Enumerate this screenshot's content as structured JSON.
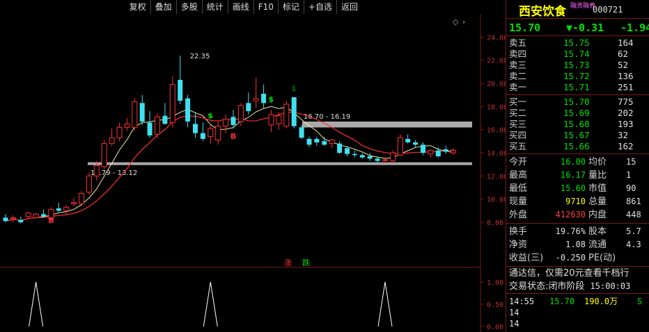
{
  "toolbar": [
    "复权",
    "叠加",
    "多股",
    "统计",
    "画线",
    "F10",
    "标记",
    "+自选",
    "返回"
  ],
  "chart_data": {
    "type": "candlestick",
    "y_axis_ticks": [
      "24.00",
      "22.00",
      "20.00",
      "18.00",
      "16.00",
      "14.00",
      "12.00",
      "10.00",
      "8.00"
    ],
    "ylim": [
      7.4,
      25.4
    ],
    "indicator_ticks": [
      "1.00",
      "0.50",
      "0.00"
    ],
    "candles": [
      {
        "o": 8.4,
        "h": 8.7,
        "l": 8.0,
        "c": 8.1
      },
      {
        "o": 8.3,
        "h": 8.6,
        "l": 8.0,
        "c": 8.4
      },
      {
        "o": 8.2,
        "h": 8.5,
        "l": 7.9,
        "c": 8.0
      },
      {
        "o": 8.5,
        "h": 8.9,
        "l": 8.3,
        "c": 8.8
      },
      {
        "o": 8.4,
        "h": 8.8,
        "l": 8.3,
        "c": 8.7
      },
      {
        "o": 8.7,
        "h": 9.1,
        "l": 8.4,
        "c": 8.5
      },
      {
        "o": 8.3,
        "h": 9.3,
        "l": 8.1,
        "c": 9.1
      },
      {
        "o": 9.2,
        "h": 9.7,
        "l": 8.9,
        "c": 9.0
      },
      {
        "o": 9.0,
        "h": 9.5,
        "l": 8.7,
        "c": 9.3
      },
      {
        "o": 9.6,
        "h": 10.1,
        "l": 9.4,
        "c": 9.7
      },
      {
        "o": 9.6,
        "h": 10.7,
        "l": 9.4,
        "c": 10.5
      },
      {
        "o": 10.6,
        "h": 12.3,
        "l": 10.4,
        "c": 12.0
      },
      {
        "o": 12.0,
        "h": 13.3,
        "l": 11.6,
        "c": 12.9
      },
      {
        "o": 12.8,
        "h": 15.1,
        "l": 12.6,
        "c": 14.8
      },
      {
        "o": 14.8,
        "h": 16.1,
        "l": 14.6,
        "c": 15.3
      },
      {
        "o": 15.3,
        "h": 16.6,
        "l": 15.0,
        "c": 16.2
      },
      {
        "o": 16.2,
        "h": 17.0,
        "l": 15.9,
        "c": 16.5
      },
      {
        "o": 16.2,
        "h": 18.7,
        "l": 15.9,
        "c": 18.4
      },
      {
        "o": 18.3,
        "h": 19.0,
        "l": 16.4,
        "c": 16.7
      },
      {
        "o": 16.6,
        "h": 17.6,
        "l": 15.3,
        "c": 15.5
      },
      {
        "o": 15.6,
        "h": 17.4,
        "l": 15.3,
        "c": 17.1
      },
      {
        "o": 17.2,
        "h": 18.3,
        "l": 16.4,
        "c": 16.5
      },
      {
        "o": 16.6,
        "h": 20.6,
        "l": 16.2,
        "c": 19.9
      },
      {
        "o": 20.3,
        "h": 22.4,
        "l": 18.2,
        "c": 18.5
      },
      {
        "o": 18.7,
        "h": 19.0,
        "l": 16.2,
        "c": 16.7
      },
      {
        "o": 16.5,
        "h": 17.5,
        "l": 15.3,
        "c": 15.7
      },
      {
        "o": 15.7,
        "h": 16.6,
        "l": 15.0,
        "c": 15.2
      },
      {
        "o": 15.4,
        "h": 16.4,
        "l": 14.8,
        "c": 16.1
      },
      {
        "o": 15.1,
        "h": 16.8,
        "l": 14.7,
        "c": 16.3
      },
      {
        "o": 16.3,
        "h": 17.3,
        "l": 15.7,
        "c": 16.9
      },
      {
        "o": 17.1,
        "h": 17.7,
        "l": 16.1,
        "c": 16.4
      },
      {
        "o": 16.7,
        "h": 18.3,
        "l": 16.3,
        "c": 18.1
      },
      {
        "o": 18.3,
        "h": 19.2,
        "l": 17.3,
        "c": 17.6
      },
      {
        "o": 18.5,
        "h": 20.5,
        "l": 17.9,
        "c": 18.7
      },
      {
        "o": 19.1,
        "h": 19.9,
        "l": 17.8,
        "c": 18.3
      },
      {
        "o": 16.4,
        "h": 17.7,
        "l": 15.8,
        "c": 17.3
      },
      {
        "o": 16.5,
        "h": 17.5,
        "l": 16.0,
        "c": 17.2
      },
      {
        "o": 16.3,
        "h": 18.5,
        "l": 16.1,
        "c": 18.2
      },
      {
        "o": 18.8,
        "h": 18.8,
        "l": 16.1,
        "c": 16.3
      },
      {
        "o": 16.2,
        "h": 16.4,
        "l": 15.2,
        "c": 15.3
      },
      {
        "o": 15.2,
        "h": 15.4,
        "l": 14.5,
        "c": 14.7
      },
      {
        "o": 15.2,
        "h": 15.4,
        "l": 14.6,
        "c": 14.9
      },
      {
        "o": 15.0,
        "h": 15.4,
        "l": 14.6,
        "c": 14.7
      },
      {
        "o": 14.8,
        "h": 15.2,
        "l": 14.4,
        "c": 15.1
      },
      {
        "o": 14.8,
        "h": 15.0,
        "l": 13.9,
        "c": 14.0
      },
      {
        "o": 14.4,
        "h": 14.6,
        "l": 13.7,
        "c": 13.9
      },
      {
        "o": 13.9,
        "h": 14.2,
        "l": 13.6,
        "c": 13.8
      },
      {
        "o": 13.8,
        "h": 14.0,
        "l": 13.5,
        "c": 13.6
      },
      {
        "o": 13.7,
        "h": 14.0,
        "l": 13.3,
        "c": 13.5
      },
      {
        "o": 13.5,
        "h": 13.7,
        "l": 13.2,
        "c": 13.3
      },
      {
        "o": 13.4,
        "h": 13.6,
        "l": 13.1,
        "c": 13.4
      },
      {
        "o": 13.3,
        "h": 14.2,
        "l": 13.1,
        "c": 14.0
      },
      {
        "o": 13.8,
        "h": 15.6,
        "l": 13.7,
        "c": 15.3
      },
      {
        "o": 15.2,
        "h": 15.6,
        "l": 14.8,
        "c": 14.9
      },
      {
        "o": 14.9,
        "h": 15.1,
        "l": 14.5,
        "c": 14.7
      },
      {
        "o": 14.7,
        "h": 14.9,
        "l": 13.8,
        "c": 14.0
      },
      {
        "o": 13.9,
        "h": 14.3,
        "l": 13.6,
        "c": 14.2
      },
      {
        "o": 14.2,
        "h": 14.5,
        "l": 13.6,
        "c": 13.7
      },
      {
        "o": 14.3,
        "h": 14.6,
        "l": 13.9,
        "c": 14.1
      },
      {
        "o": 14.0,
        "h": 14.4,
        "l": 13.8,
        "c": 14.2
      }
    ],
    "annotations": {
      "high_label": "22.35",
      "low_zone_label": "12.79 - 13.12",
      "high_zone_label": "16.70 - 16.19",
      "b_marker": "B",
      "s_marker": "$",
      "indicator_label_up": "涨",
      "indicator_label_down": "跌"
    }
  },
  "quote": {
    "name": "西安饮食",
    "tag": "融资融券",
    "code": "000721",
    "price": "15.70",
    "change": "▼-0.31",
    "change_pct": "-1.94",
    "asks": [
      {
        "label": "卖五",
        "price": "15.75",
        "vol": "164"
      },
      {
        "label": "卖四",
        "price": "15.74",
        "vol": "62"
      },
      {
        "label": "卖三",
        "price": "15.73",
        "vol": "52"
      },
      {
        "label": "卖二",
        "price": "15.72",
        "vol": "136"
      },
      {
        "label": "卖一",
        "price": "15.71",
        "vol": "251"
      }
    ],
    "bids": [
      {
        "label": "买一",
        "price": "15.70",
        "vol": "775"
      },
      {
        "label": "买二",
        "price": "15.69",
        "vol": "202"
      },
      {
        "label": "买三",
        "price": "15.68",
        "vol": "193"
      },
      {
        "label": "买四",
        "price": "15.67",
        "vol": "32"
      },
      {
        "label": "买五",
        "price": "15.66",
        "vol": "162"
      }
    ],
    "stats": [
      {
        "l1": "今开",
        "v1": "16.00",
        "c1": "g",
        "l2": "均价",
        "v2": "15"
      },
      {
        "l1": "最高",
        "v1": "16.17",
        "c1": "g",
        "l2": "量比",
        "v2": "1"
      },
      {
        "l1": "最低",
        "v1": "15.60",
        "c1": "g",
        "l2": "市值",
        "v2": "90"
      },
      {
        "l1": "现量",
        "v1": "9710",
        "c1": "y",
        "l2": "总量",
        "v2": "861"
      },
      {
        "l1": "外盘",
        "v1": "412630",
        "c1": "r",
        "l2": "内盘",
        "v2": "448"
      }
    ],
    "stats2": [
      {
        "l1": "换手",
        "v1": "19.76%",
        "l2": "股本",
        "v2": "5.7"
      },
      {
        "l1": "净资",
        "v1": "1.08",
        "l2": "流通",
        "v2": "4.3"
      },
      {
        "l1": "收益(三)",
        "v1": "-0.250",
        "l2": "PE(动)",
        "v2": ""
      }
    ],
    "notice": "通达信，仅需20元查看千档行",
    "trade_status_label": "交易状态:",
    "trade_status": "闭市阶段",
    "trade_time": "15:00:03",
    "ticks": [
      {
        "time": "14:55",
        "price": "15.70",
        "vol": "190.0万",
        "side": "S"
      },
      {
        "time": "14",
        "price": "",
        "vol": "",
        "side": ""
      },
      {
        "time": "14",
        "price": "",
        "vol": "",
        "side": ""
      }
    ]
  }
}
